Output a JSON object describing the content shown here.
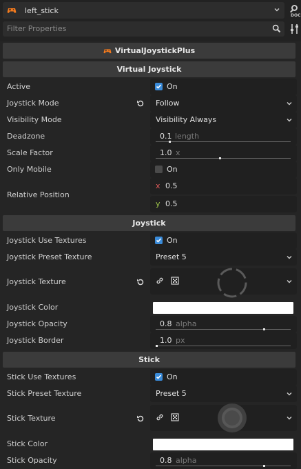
{
  "header": {
    "node_name": "left_stick",
    "doc_label": "DOC",
    "filter_placeholder": "Filter Properties"
  },
  "colors": {
    "accent": "#3a8bd9",
    "game_icon": "#f47b1e",
    "axis_x": "#e05a5a",
    "axis_y": "#9ec54a"
  },
  "inspector": {
    "class_name": "VirtualJoystickPlus",
    "sections": {
      "virtual_joystick": "Virtual Joystick",
      "joystick": "Joystick",
      "stick": "Stick"
    },
    "props": {
      "active": {
        "label": "Active",
        "value": "On",
        "checked": true
      },
      "joystick_mode": {
        "label": "Joystick Mode",
        "value": "Follow"
      },
      "visibility_mode": {
        "label": "Visibility Mode",
        "value": "Visibility Always"
      },
      "deadzone": {
        "label": "Deadzone",
        "value": "0.1",
        "unit": "length",
        "fraction": 0.1
      },
      "scale_factor": {
        "label": "Scale Factor",
        "value": "1.0",
        "unit": "x",
        "fraction": 0.48
      },
      "only_mobile": {
        "label": "Only Mobile",
        "value": "On",
        "checked": false
      },
      "relative_position": {
        "label": "Relative Position",
        "x_label": "x",
        "x": "0.5",
        "y_label": "y",
        "y": "0.5"
      },
      "joystick_use_textures": {
        "label": "Joystick Use Textures",
        "value": "On",
        "checked": true
      },
      "joystick_preset_texture": {
        "label": "Joystick Preset Texture",
        "value": "Preset 5"
      },
      "joystick_texture": {
        "label": "Joystick Texture"
      },
      "joystick_color": {
        "label": "Joystick Color",
        "color": "#ffffff"
      },
      "joystick_opacity": {
        "label": "Joystick Opacity",
        "value": "0.8",
        "unit": "alpha",
        "fraction": 0.8
      },
      "joystick_border": {
        "label": "Joystick Border",
        "value": "1.0",
        "unit": "px",
        "fraction": 0.0
      },
      "stick_use_textures": {
        "label": "Stick Use Textures",
        "value": "On",
        "checked": true
      },
      "stick_preset_texture": {
        "label": "Stick Preset Texture",
        "value": "Preset 5"
      },
      "stick_texture": {
        "label": "Stick Texture"
      },
      "stick_color": {
        "label": "Stick Color",
        "color": "#ffffff"
      },
      "stick_opacity": {
        "label": "Stick Opacity",
        "value": "0.8",
        "unit": "alpha",
        "fraction": 0.8
      }
    }
  }
}
